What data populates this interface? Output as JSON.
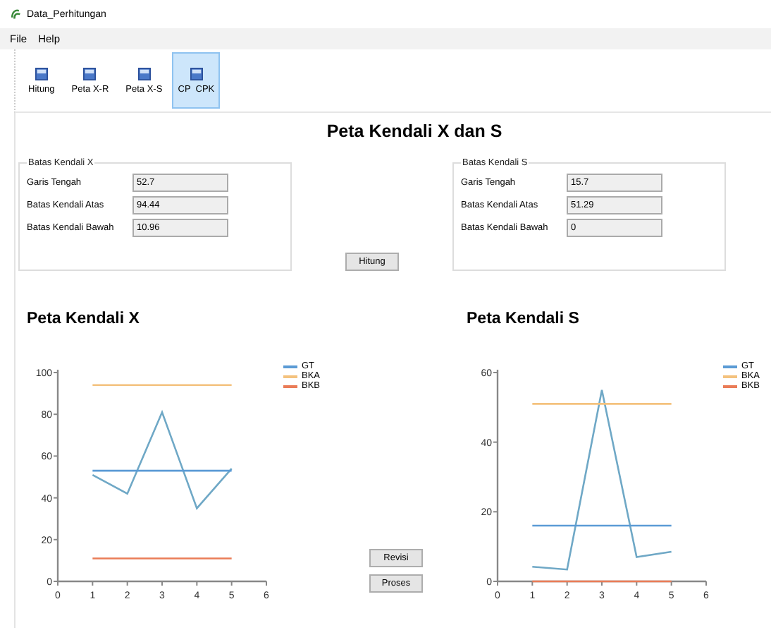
{
  "window": {
    "title": "Data_Perhitungan"
  },
  "menu": [
    "File",
    "Help"
  ],
  "toolbar": [
    {
      "label": "Hitung",
      "selected": false
    },
    {
      "label": "Peta X-R",
      "selected": false
    },
    {
      "label": "Peta X-S",
      "selected": false
    },
    {
      "label": "CP  CPK",
      "selected": true
    }
  ],
  "heading": "Peta Kendali X dan S",
  "groups": [
    {
      "title": "Batas Kendali X",
      "fields": [
        {
          "label": "Garis Tengah",
          "value": "52.7"
        },
        {
          "label": "Batas Kendali Atas",
          "value": "94.44"
        },
        {
          "label": "Batas Kendali Bawah",
          "value": "10.96"
        }
      ]
    },
    {
      "title": "Batas Kendali S",
      "fields": [
        {
          "label": "Garis Tengah",
          "value": "15.7"
        },
        {
          "label": "Batas Kendali Atas",
          "value": "51.29"
        },
        {
          "label": "Batas Kendali Bawah",
          "value": "0"
        }
      ]
    }
  ],
  "calc_button": "Hitung",
  "side_buttons": [
    "Revisi",
    "Proses"
  ],
  "charts": [
    {
      "title": "Peta Kendali X",
      "chart_data": {
        "type": "line",
        "x": [
          1,
          2,
          3,
          4,
          5
        ],
        "xlim": [
          0,
          6
        ],
        "ylim": [
          0,
          100
        ],
        "xticks": [
          0,
          1,
          2,
          3,
          4,
          5,
          6
        ],
        "yticks": [
          0,
          20,
          40,
          60,
          80,
          100
        ],
        "series": [
          {
            "color": "#6fa8c6",
            "values": [
              51,
              42,
              81,
              35,
              54
            ]
          },
          {
            "name": "GT",
            "color": "#5b9bd5",
            "values": [
              53,
              53,
              53,
              53,
              53
            ]
          },
          {
            "name": "BKA",
            "color": "#f4c27e",
            "values": [
              94,
              94,
              94,
              94,
              94
            ]
          },
          {
            "name": "BKB",
            "color": "#ea7c57",
            "values": [
              11,
              11,
              11,
              11,
              11
            ]
          }
        ]
      }
    },
    {
      "title": "Peta Kendali S",
      "chart_data": {
        "type": "line",
        "x": [
          1,
          2,
          3,
          4,
          5
        ],
        "xlim": [
          0,
          6
        ],
        "ylim": [
          0,
          60
        ],
        "xticks": [
          0,
          1,
          2,
          3,
          4,
          5,
          6
        ],
        "yticks": [
          0,
          20,
          40,
          60
        ],
        "series": [
          {
            "color": "#6fa8c6",
            "values": [
              4.2,
              3.4,
              55,
              7,
              8.5
            ]
          },
          {
            "name": "GT",
            "color": "#5b9bd5",
            "values": [
              16,
              16,
              16,
              16,
              16
            ]
          },
          {
            "name": "BKA",
            "color": "#f4c27e",
            "values": [
              51,
              51,
              51,
              51,
              51
            ]
          },
          {
            "name": "BKB",
            "color": "#ea7c57",
            "values": [
              0,
              0,
              0,
              0,
              0
            ]
          }
        ]
      }
    }
  ]
}
